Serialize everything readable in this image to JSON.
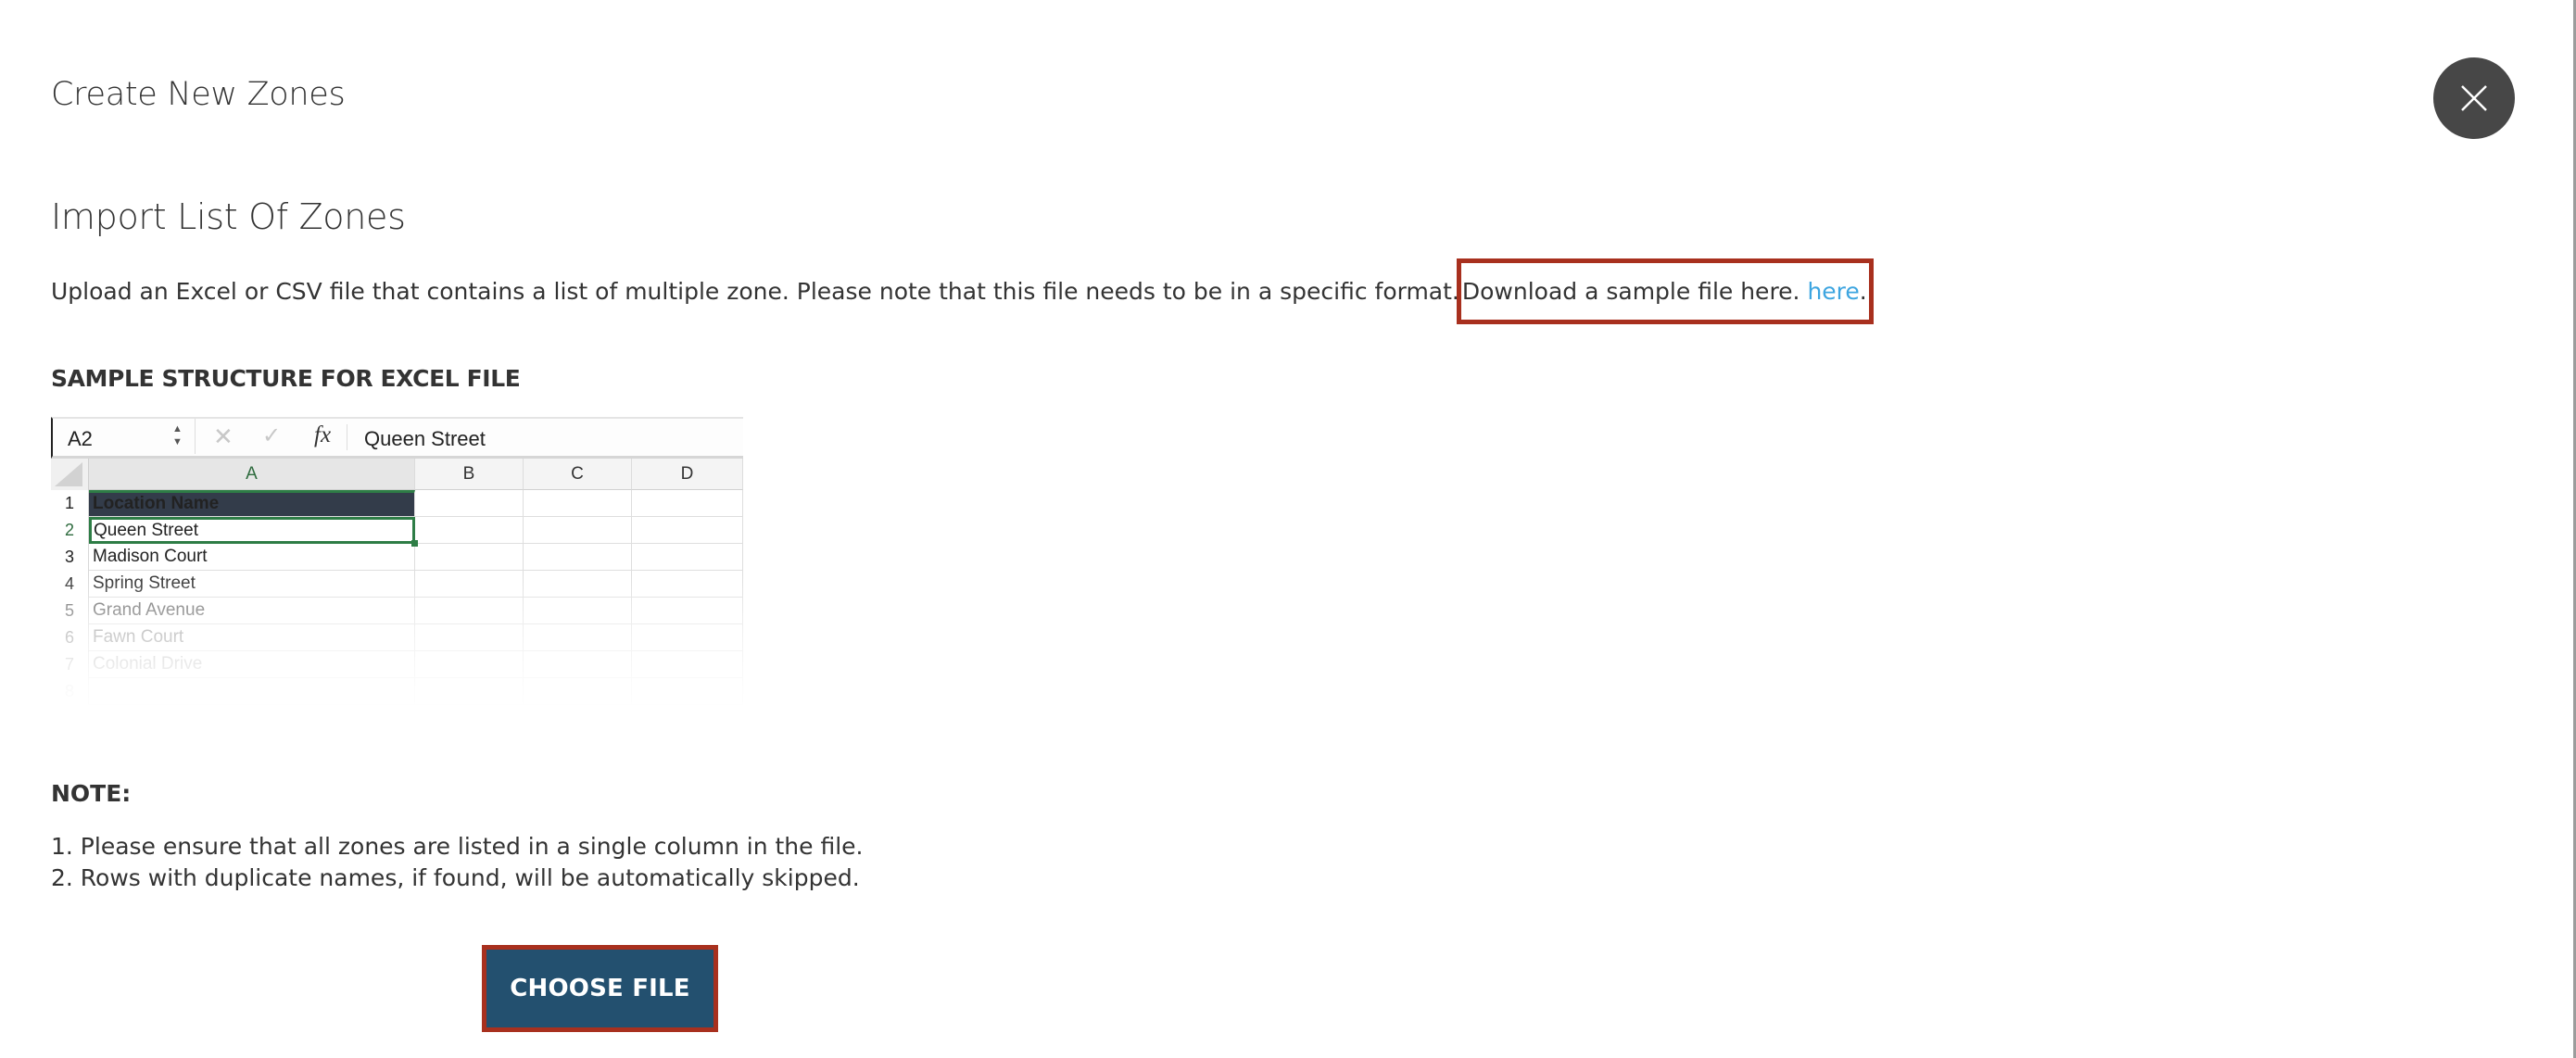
{
  "modal": {
    "title": "Create New Zones",
    "close_icon": "close-icon"
  },
  "import_section": {
    "title": "Import List Of Zones",
    "description": "Upload an Excel or CSV file that contains a list of multiple zone. Please note that this file needs to be in a specific format.",
    "download_text": "Download a sample file here.",
    "download_link": "here",
    "download_suffix": ".",
    "link_color": "#3da5e0",
    "highlight_color": "#a8301e"
  },
  "sample": {
    "label": "SAMPLE STRUCTURE FOR EXCEL FILE",
    "spreadsheet": {
      "name_box": "A2",
      "formula_icons": [
        "cancel-icon",
        "confirm-icon",
        "fx-icon"
      ],
      "fx_label": "fx",
      "formula_value": "Queen Street",
      "columns": [
        "A",
        "B",
        "C",
        "D"
      ],
      "rows": [
        {
          "num": "1",
          "value": "Location Name"
        },
        {
          "num": "2",
          "value": "Queen Street"
        },
        {
          "num": "3",
          "value": "Madison Court"
        },
        {
          "num": "4",
          "value": "Spring Street"
        },
        {
          "num": "5",
          "value": "Grand Avenue"
        },
        {
          "num": "6",
          "value": "Fawn Court"
        },
        {
          "num": "7",
          "value": "Colonial Drive"
        },
        {
          "num": "8",
          "value": ""
        }
      ],
      "header_fill": "#333c4a",
      "selection_color": "#2e7d46"
    }
  },
  "notes": {
    "label": "NOTE:",
    "items": [
      "1. Please ensure that all zones are listed in a single column in the file.",
      "2. Rows with duplicate names, if found, will be automatically skipped."
    ]
  },
  "actions": {
    "choose_file": "CHOOSE FILE",
    "button_color": "#23506f"
  }
}
